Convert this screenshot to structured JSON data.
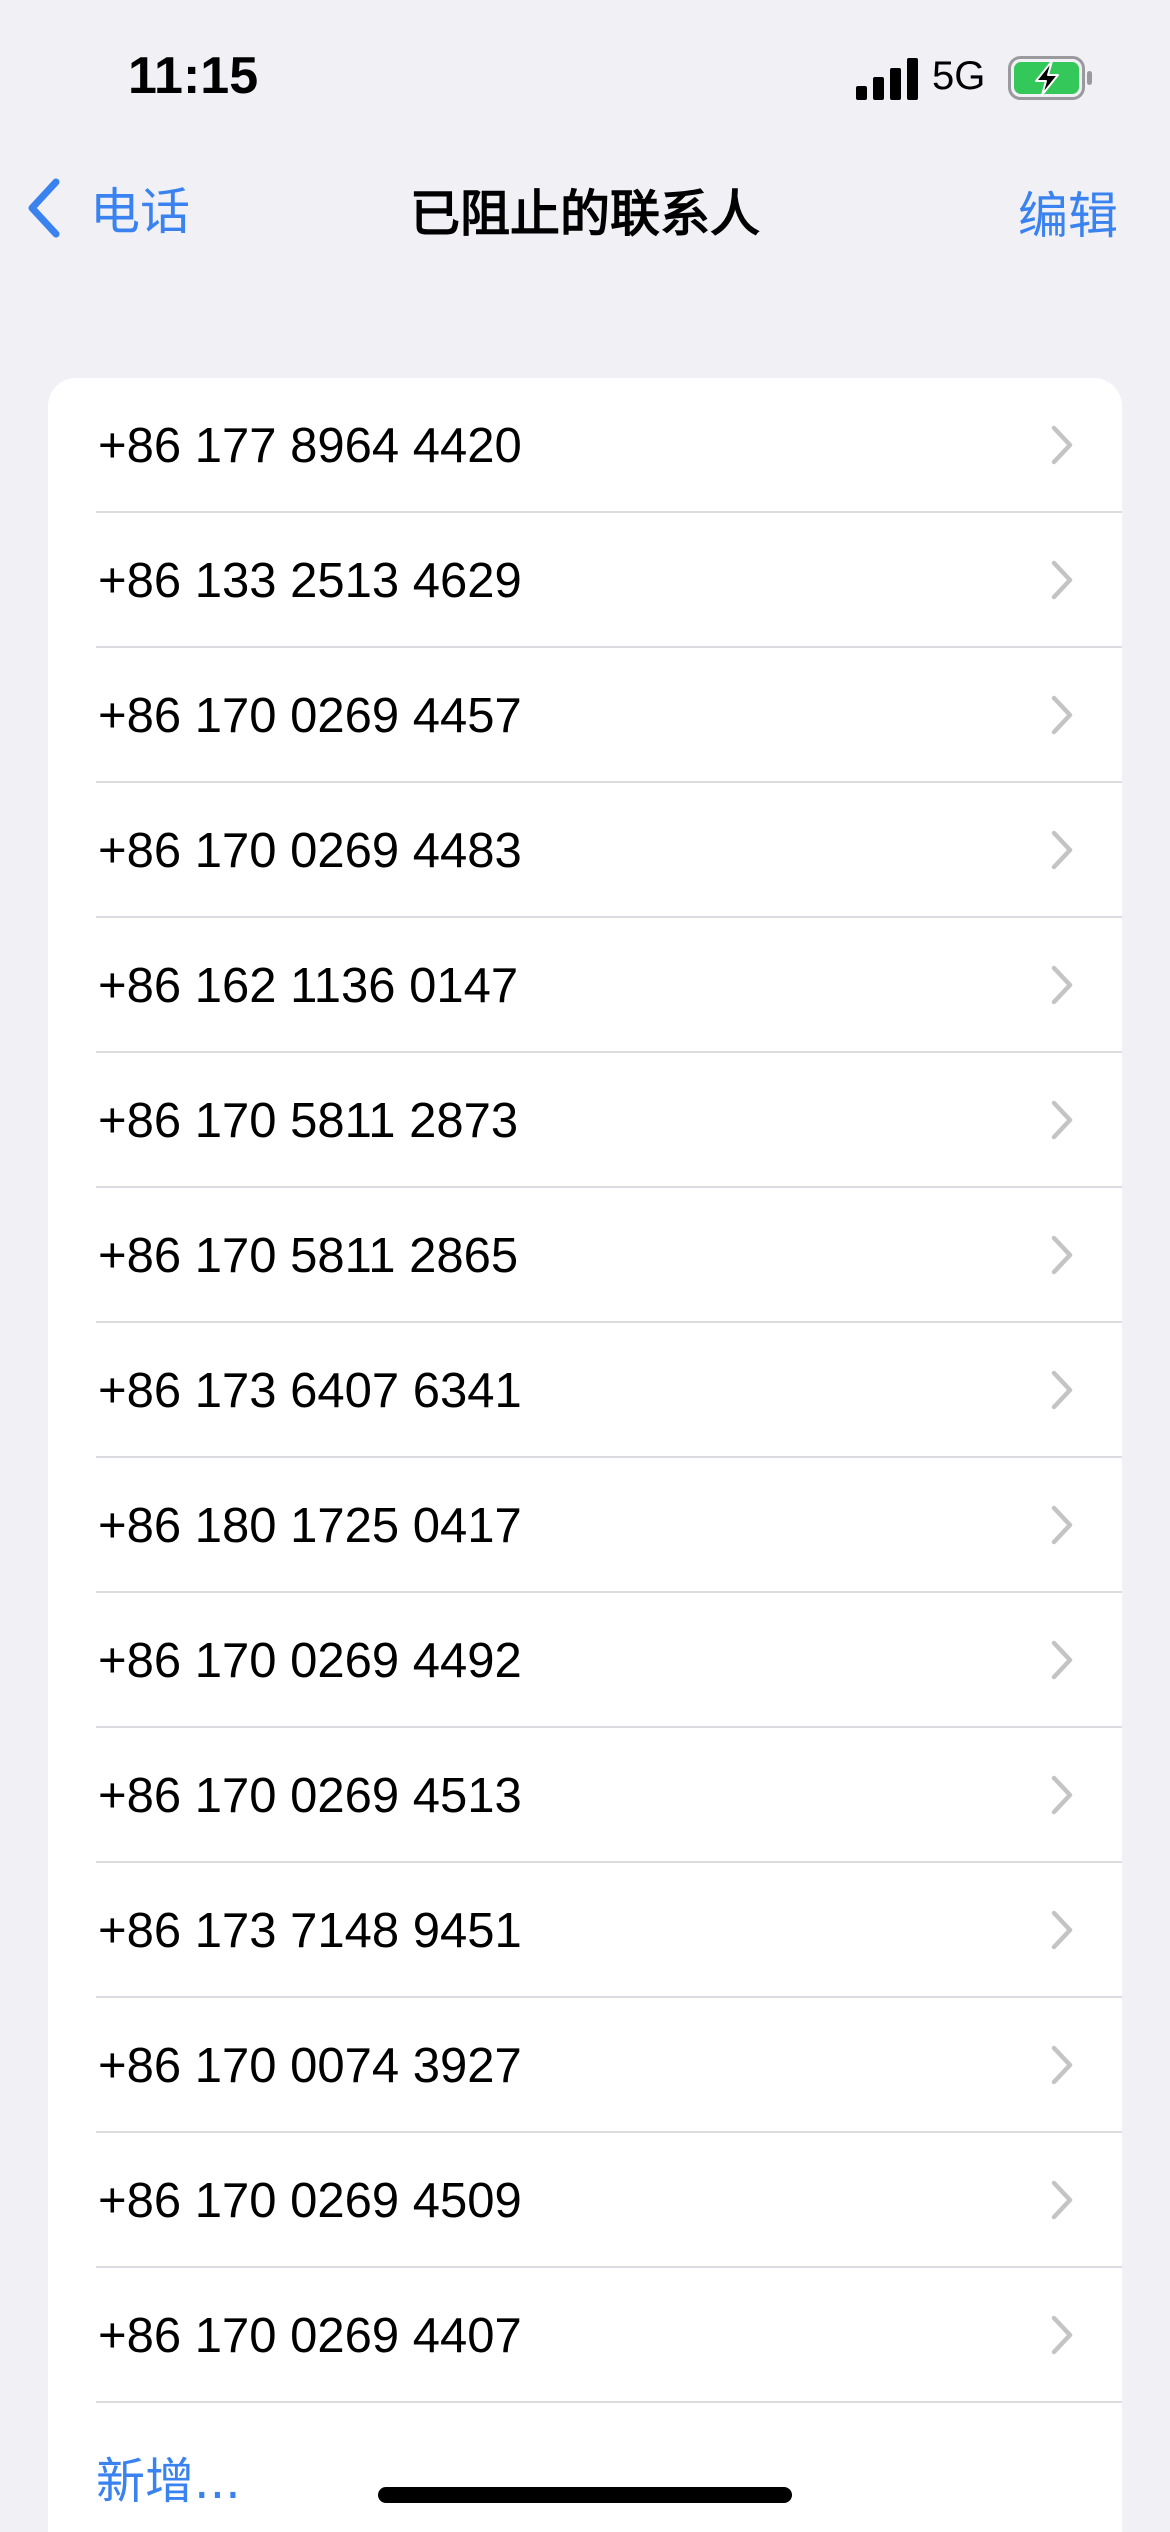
{
  "status_bar": {
    "time": "11:15",
    "network": "5G",
    "battery_color": "#34C759"
  },
  "nav": {
    "back_label": "电话",
    "title": "已阻止的联系人",
    "edit_label": "编辑",
    "accent_color": "#3A82F0"
  },
  "blocked_numbers": [
    "+86 177 8964 4420",
    "+86 133 2513 4629",
    "+86 170 0269 4457",
    "+86 170 0269 4483",
    "+86 162 1136 0147",
    "+86 170 5811 2873",
    "+86 170 5811 2865",
    "+86 173 6407 6341",
    "+86 180 1725 0417",
    "+86 170 0269 4492",
    "+86 170 0269 4513",
    "+86 173 7148 9451",
    "+86 170 0074 3927",
    "+86 170 0269 4509",
    "+86 170 0269 4407"
  ],
  "add_label": "新增..."
}
